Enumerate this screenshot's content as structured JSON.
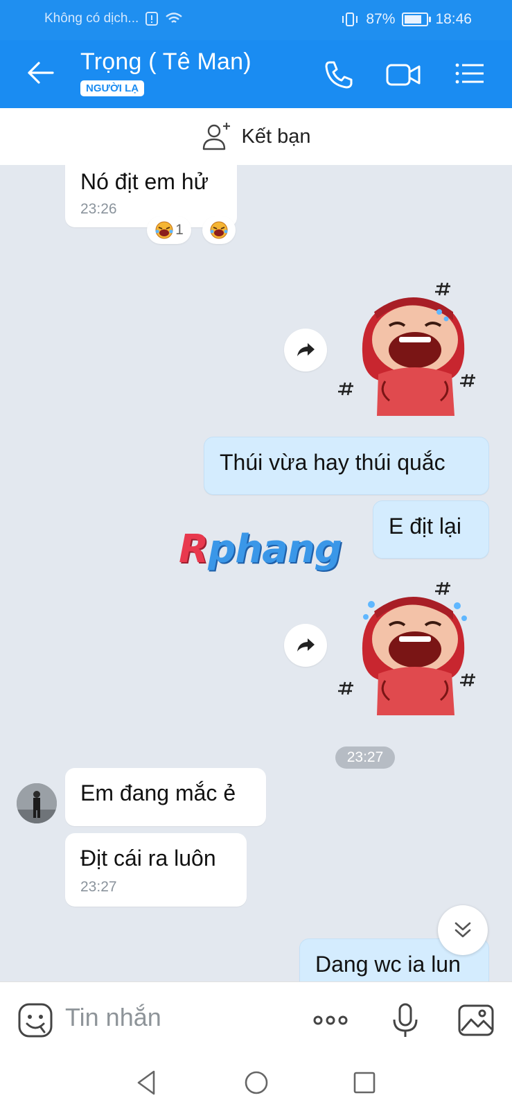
{
  "status_bar": {
    "carrier": "Không có dịch...",
    "battery_percent": "87%",
    "battery_level": 0.87,
    "time": "18:46"
  },
  "header": {
    "contact_name": "Trọng ( Tê Man)",
    "badge": "NGƯỜI LẠ"
  },
  "add_friend": {
    "label": "Kết bạn"
  },
  "messages": {
    "m1": {
      "text": "Nó địt em hử",
      "time": "23:26",
      "reaction_count": "1"
    },
    "m2": {
      "text": "Thúi vừa hay thúi quắc"
    },
    "m3": {
      "text": "E địt lại"
    },
    "time_divider": "23:27",
    "m4": {
      "text": "Em đang mắc ẻ"
    },
    "m5": {
      "text": "Địt cái ra luôn",
      "time": "23:27"
    },
    "m6": {
      "text": "Dang wc ia lun"
    }
  },
  "watermark": {
    "first": "R",
    "rest": "phang"
  },
  "input": {
    "placeholder": "Tin nhắn"
  },
  "colors": {
    "primary": "#1a8cf2",
    "chat_bg": "#e3e8ef",
    "outgoing_bubble": "#d4ecfe"
  }
}
